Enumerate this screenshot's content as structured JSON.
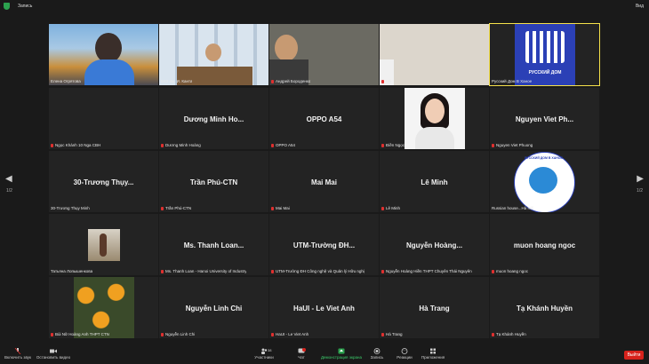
{
  "top": {
    "recording": "Запись",
    "view": "Вид"
  },
  "pager": {
    "left": "1/2",
    "right": "1/2"
  },
  "tiles": [
    {
      "label": "Елена Огрятова",
      "type": "video",
      "muted": false
    },
    {
      "label": "БКЗ им. И. Канта",
      "type": "video",
      "muted": false
    },
    {
      "label": "Андрей Бороденко",
      "type": "video",
      "muted": true
    },
    {
      "label": "Hà",
      "type": "video",
      "muted": true
    },
    {
      "label": "Русский Дом В Ханое",
      "type": "logo",
      "logo_text": "РУССКИЙ ДОМ",
      "muted": false,
      "active": true
    },
    {
      "label": "Ngọc Khánh 10 Nga CBH",
      "type": "blank",
      "muted": true
    },
    {
      "label": "Dương Minh Hoàng",
      "name": "Dương Minh Ho...",
      "type": "name",
      "muted": true
    },
    {
      "label": "OPPO A54",
      "name": "OPPO A54",
      "type": "name",
      "muted": true
    },
    {
      "label": "Điền Ngọc",
      "type": "photo",
      "muted": true
    },
    {
      "label": "Nguyen Viet Phuong",
      "name": "Nguyen Viet Ph...",
      "type": "name",
      "muted": true
    },
    {
      "label": "30-Trương Thụy Minh",
      "name": "30-Trương Thụy...",
      "type": "name",
      "muted": false
    },
    {
      "label": "Trần Phú-CTN",
      "name": "Trần Phú-CTN",
      "type": "name",
      "muted": true
    },
    {
      "label": "Mai Mai",
      "name": "Mai Mai",
      "type": "name",
      "muted": true
    },
    {
      "label": "Lê Minh",
      "name": "Lê Minh",
      "type": "name",
      "muted": true
    },
    {
      "label": "Russian house...Hà Nội",
      "type": "badge",
      "badge_text": "РУССКИЙ ДОМ В ХАНОЕ",
      "muted": false
    },
    {
      "label": "Татьяна Лопышенкова",
      "type": "smallphoto",
      "muted": false
    },
    {
      "label": "Ms. Thanh Loan - Hanoi University of Industry",
      "name": "Ms. Thanh Loan...",
      "type": "name",
      "muted": true
    },
    {
      "label": "UTM-Trường ĐH Công nghệ và Quản lý Hữu nghị",
      "name": "UTM-Trường ĐH...",
      "type": "name",
      "muted": true
    },
    {
      "label": "Nguyễn Hoàng Hiền THPT Chuyên Thái Nguyên",
      "name": "Nguyễn Hoàng...",
      "type": "name",
      "muted": true
    },
    {
      "label": "muon hoang ngoc",
      "name": "muon hoang ngoc",
      "type": "name",
      "muted": true
    },
    {
      "label": "Bùi Nữ Hoàng Anh THPT CTN",
      "type": "flowers",
      "muted": true
    },
    {
      "label": "Nguyễn Linh Chi",
      "name": "Nguyễn Linh Chi",
      "type": "name",
      "muted": true
    },
    {
      "label": "HaUI - Le Viet Anh",
      "name": "HaUI - Le Viet Anh",
      "type": "name",
      "muted": true
    },
    {
      "label": "Hà Trang",
      "name": "Hà Trang",
      "type": "name",
      "muted": true
    },
    {
      "label": "Tạ Khánh Huyền",
      "name": "Tạ Khánh Huyền",
      "type": "name",
      "muted": true
    }
  ],
  "toolbar": {
    "unmute": "Включить звук",
    "stop_video": "Остановить видео",
    "participants": "Участники",
    "participants_count": "38",
    "chat": "Чат",
    "share": "Демонстрация экрана",
    "record": "Запись",
    "reactions": "Реакции",
    "apps": "Приложения",
    "leave": "Выйти"
  }
}
